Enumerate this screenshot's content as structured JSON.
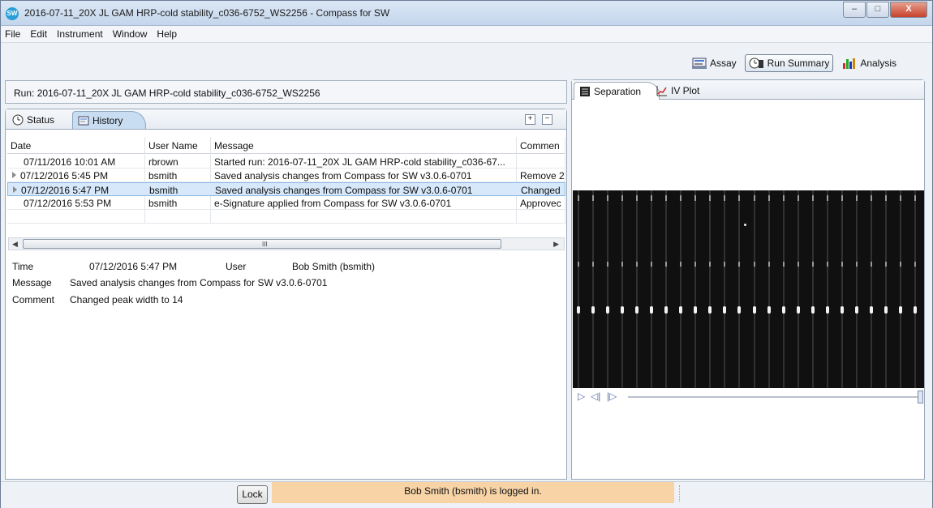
{
  "window": {
    "title": "2016-07-11_20X JL GAM HRP-cold stability_c036-6752_WS2256 - Compass for SW",
    "app_icon_text": "SW",
    "minimize_glyph": "–",
    "maximize_glyph": "□",
    "close_glyph": "X"
  },
  "menu": [
    "File",
    "Edit",
    "Instrument",
    "Window",
    "Help"
  ],
  "perspectives": {
    "assay": "Assay",
    "run_summary": "Run Summary",
    "analysis": "Analysis",
    "active": "Run Summary"
  },
  "run": {
    "label": "Run:",
    "name": "2016-07-11_20X JL GAM HRP-cold stability_c036-6752_WS2256"
  },
  "left_tabs": {
    "status": "Status",
    "history": "History",
    "active": "History",
    "expand_glyph": "+",
    "collapse_glyph": "−"
  },
  "history_table": {
    "columns": [
      "Date",
      "User Name",
      "Message",
      "Commen"
    ],
    "rows": [
      {
        "date": "07/11/2016 10:01 AM",
        "user": "rbrown",
        "message": "Started run: 2016-07-11_20X JL GAM HRP-cold stability_c036-67...",
        "comment": "",
        "expandable": false
      },
      {
        "date": "07/12/2016 5:45 PM",
        "user": "bsmith",
        "message": "Saved analysis changes from Compass for SW v3.0.6-0701",
        "comment": "Remove 2",
        "expandable": true
      },
      {
        "date": "07/12/2016 5:47 PM",
        "user": "bsmith",
        "message": "Saved analysis changes from Compass for SW v3.0.6-0701",
        "comment": "Changed",
        "expandable": true,
        "selected": true
      },
      {
        "date": "07/12/2016 5:53 PM",
        "user": "bsmith",
        "message": "e-Signature applied from Compass for SW v3.0.6-0701",
        "comment": "Approvec",
        "expandable": false
      }
    ]
  },
  "scrollbar": {
    "left": "◀",
    "right": "▶",
    "grip": "III"
  },
  "details": {
    "time_label": "Time",
    "time_value": "07/12/2016 5:47 PM",
    "user_label": "User",
    "user_value": "Bob Smith (bsmith)",
    "message_label": "Message",
    "message_value": "Saved analysis changes from Compass for SW v3.0.6-0701",
    "comment_label": "Comment",
    "comment_value": "Changed peak width to 14"
  },
  "right_tabs": {
    "separation": "Separation",
    "iv_plot": "IV Plot",
    "active": "Separation"
  },
  "player": {
    "play": "▷",
    "step_back": "◁|",
    "step_forward": "|▷"
  },
  "status_bar": {
    "lock_label": "Lock",
    "login_message": "Bob Smith (bsmith) is logged in.",
    "login_color": "#f7d3a6"
  }
}
